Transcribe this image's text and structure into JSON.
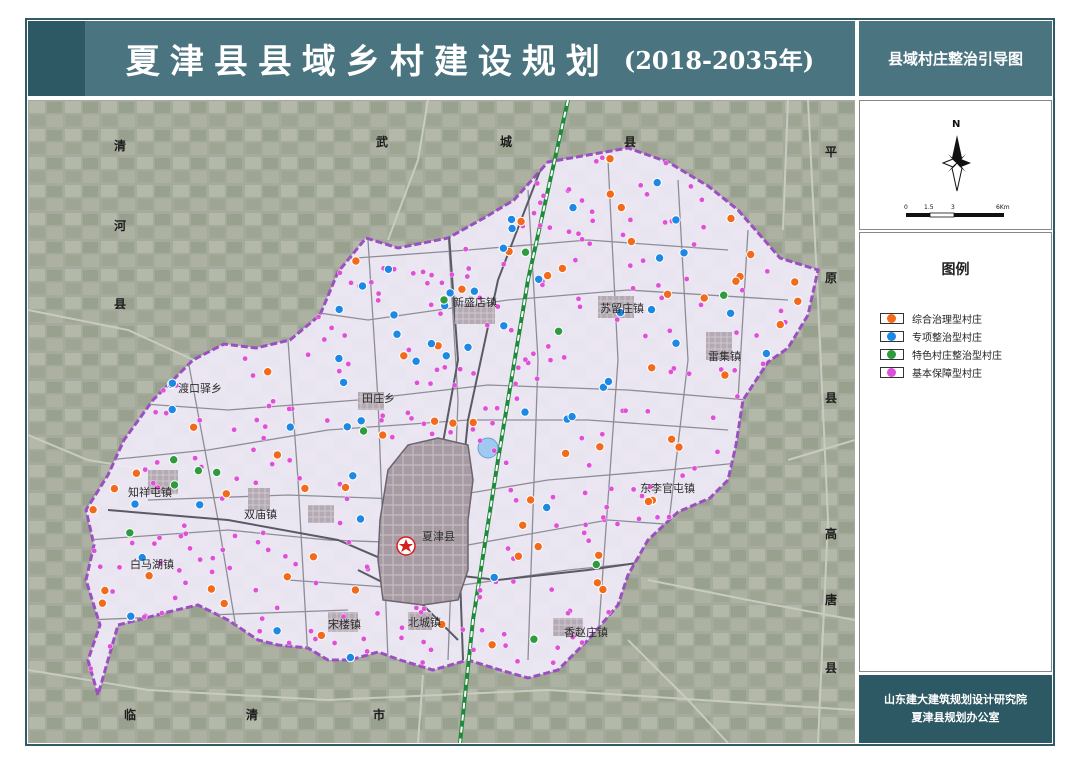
{
  "header": {
    "title_main": "夏津县县域乡村建设规划",
    "title_years": "(2018-2035年)",
    "subtitle": "县域村庄整治引导图"
  },
  "compass": {
    "north": "N",
    "scale_ticks": [
      "0",
      "1.5",
      "3",
      "6Km"
    ]
  },
  "legend": {
    "title": "图例",
    "items": [
      {
        "label": "综合治理型村庄",
        "color": "#f26a1b"
      },
      {
        "label": "专项整治型村庄",
        "color": "#1e88e5"
      },
      {
        "label": "特色村庄整治型村庄",
        "color": "#2e9b3c"
      },
      {
        "label": "基本保障型村庄",
        "color": "#e04fd8"
      }
    ]
  },
  "credits": {
    "line1": "山东建大建筑规划设计研究院",
    "line2": "夏津县规划办公室"
  },
  "map": {
    "surrounding_labels": {
      "qinghe": [
        "清",
        "河",
        "县"
      ],
      "wucheng": [
        "武",
        "城",
        "县"
      ],
      "pingyuan": [
        "平",
        "原",
        "县"
      ],
      "gaotang": [
        "高",
        "唐",
        "县"
      ],
      "linqing": [
        "临",
        "清",
        "市"
      ]
    },
    "towns": [
      {
        "name": "新盛店镇"
      },
      {
        "name": "苏留庄镇"
      },
      {
        "name": "雷集镇"
      },
      {
        "name": "渡口驿乡"
      },
      {
        "name": "田庄乡"
      },
      {
        "name": "东李官屯镇"
      },
      {
        "name": "知祥屯镇"
      },
      {
        "name": "双庙镇"
      },
      {
        "name": "夏津县"
      },
      {
        "name": "白马湖镇"
      },
      {
        "name": "宋楼镇"
      },
      {
        "name": "北城镇"
      },
      {
        "name": "香赵庄镇"
      }
    ],
    "colors": {
      "comprehensive": "#f26a1b",
      "special": "#1e88e5",
      "characteristic": "#2e9b3c",
      "basic": "#e04fd8",
      "county_fill": "#efe9f7",
      "boundary": "#9b4fc2",
      "railway": "#1f8a3a"
    },
    "village_counts": {
      "comprehensive": 60,
      "special": 50,
      "characteristic": 12,
      "basic": 260
    }
  }
}
